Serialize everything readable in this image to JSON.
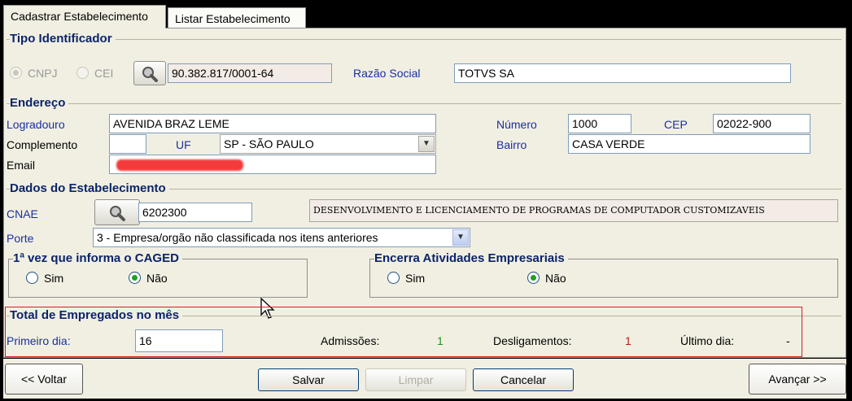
{
  "tabs": [
    {
      "label": "Cadastrar Estabelecimento"
    },
    {
      "label": "Listar Estabelecimento"
    }
  ],
  "tipo": {
    "title": "Tipo Identificador",
    "cnpj_label": "CNPJ",
    "cei_label": "CEI",
    "selected": "CNPJ",
    "identifier_value": "90.382.817/0001-64",
    "razao_label": "Razão Social",
    "razao_value": "TOTVS SA"
  },
  "endereco": {
    "title": "Endereço",
    "logradouro_label": "Logradouro",
    "logradouro_value": "AVENIDA BRAZ LEME",
    "numero_label": "Número",
    "numero_value": "1000",
    "cep_label": "CEP",
    "cep_value": "02022-900",
    "complemento_label": "Complemento",
    "complemento_value": "",
    "uf_label": "UF",
    "uf_value": "SP - SÃO PAULO",
    "bairro_label": "Bairro",
    "bairro_value": "CASA VERDE",
    "email_label": "Email",
    "email_value": ""
  },
  "dados": {
    "title": "Dados do Estabelecimento",
    "cnae_label": "CNAE",
    "cnae_value": "6202300",
    "cnae_desc": "DESENVOLVIMENTO E LICENCIAMENTO DE PROGRAMAS DE COMPUTADOR CUSTOMIZAVEIS",
    "porte_label": "Porte",
    "porte_value": "3 - Empresa/orgão não classificada nos itens anteriores"
  },
  "caged": {
    "title": "1ª vez que informa o CAGED",
    "sim": "Sim",
    "nao": "Não",
    "selected": "Não"
  },
  "encerra": {
    "title": "Encerra Atividades Empresariais",
    "sim": "Sim",
    "nao": "Não",
    "selected": "Não"
  },
  "total": {
    "title": "Total de Empregados no mês",
    "primeiro_label": "Primeiro dia:",
    "primeiro_value": "16",
    "admissoes_label": "Admissões:",
    "admissoes_value": "1",
    "desligamentos_label": "Desligamentos:",
    "desligamentos_value": "1",
    "ultimo_label": "Último dia:",
    "ultimo_value": "-"
  },
  "buttons": {
    "voltar": "<< Voltar",
    "salvar": "Salvar",
    "limpar": "Limpar",
    "cancelar": "Cancelar",
    "avancar": "Avançar >>"
  },
  "colors": {
    "label_blue": "#1a2fa0",
    "admissoes": "#1f8f1f",
    "desligamentos": "#c01818",
    "highlight_border": "#d02020"
  },
  "icons": [
    "search-icon",
    "chevron-down-icon",
    "mouse-cursor-icon"
  ]
}
